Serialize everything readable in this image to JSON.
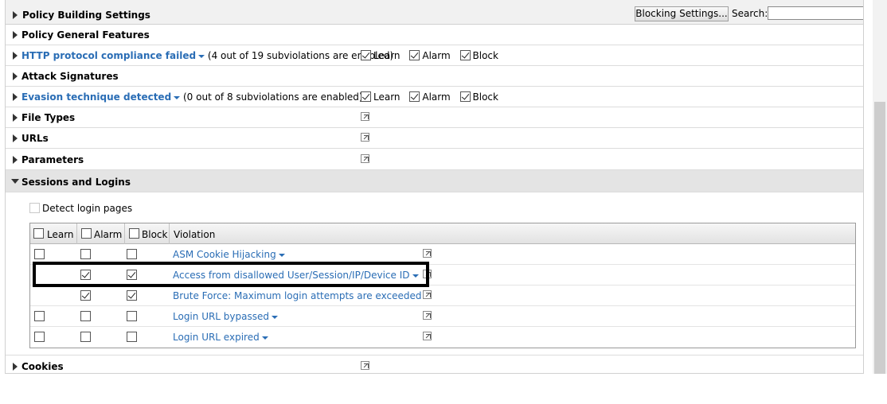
{
  "header": {
    "title": "Policy Building Settings",
    "blocking_button": "Blocking Settings...",
    "search_label": "Search:",
    "search_value": ""
  },
  "flag_labels": {
    "learn": "Learn",
    "alarm": "Alarm",
    "block": "Block"
  },
  "sections": [
    {
      "title": "Policy General Features"
    },
    {
      "title": "HTTP protocol compliance failed",
      "note": "(4 out of 19 subviolations are enabled)",
      "learn": true,
      "alarm": true,
      "block": true
    },
    {
      "title": "Attack Signatures"
    },
    {
      "title": "Evasion technique detected",
      "note": "(0 out of 8 subviolations are enabled)",
      "learn": true,
      "alarm": true,
      "block": true
    },
    {
      "title": "File Types"
    },
    {
      "title": "URLs"
    },
    {
      "title": "Parameters"
    },
    {
      "title": "Sessions and Logins"
    },
    {
      "title": "Cookies"
    }
  ],
  "sessions": {
    "detect_login_label": "Detect login pages",
    "detect_login_checked": false,
    "columns": {
      "learn": "Learn",
      "alarm": "Alarm",
      "block": "Block",
      "violation": "Violation"
    },
    "violations": [
      {
        "name": "ASM Cookie Hijacking",
        "learn": false,
        "alarm": false,
        "block": false,
        "learn_available": true
      },
      {
        "name": "Access from disallowed User/Session/IP/Device ID",
        "learn": false,
        "alarm": true,
        "block": true,
        "learn_available": false
      },
      {
        "name": "Brute Force: Maximum login attempts are exceeded",
        "learn": false,
        "alarm": true,
        "block": true,
        "learn_available": false
      },
      {
        "name": "Login URL bypassed",
        "learn": false,
        "alarm": false,
        "block": false,
        "learn_available": true
      },
      {
        "name": "Login URL expired",
        "learn": false,
        "alarm": false,
        "block": false,
        "learn_available": true
      }
    ]
  },
  "icons": {
    "expand": "triangle-right-icon",
    "collapse": "triangle-down-icon",
    "external": "external-link-icon",
    "dropdown": "caret-down-icon"
  },
  "colors": {
    "link": "#2a6db5",
    "highlight_border": "#000000",
    "expanded_row": "#e4e4e4"
  }
}
